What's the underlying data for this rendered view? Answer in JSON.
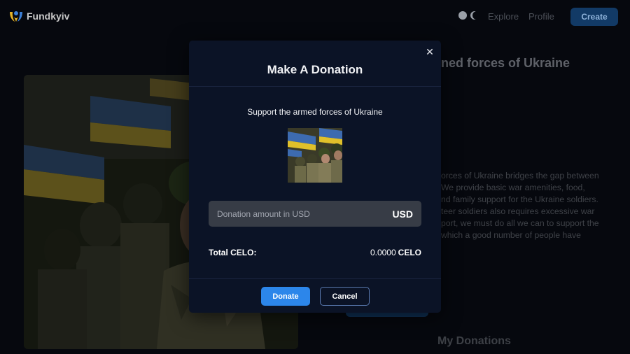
{
  "app": {
    "name": "Fundkyiv"
  },
  "nav": {
    "explore": "Explore",
    "profile": "Profile",
    "create": "Create"
  },
  "campaign": {
    "title": "Support the armed forces of Ukraine",
    "visible_title": "ned forces of Ukraine",
    "description_lines": [
      "orces of Ukraine bridges the gap between",
      "We provide basic war amenities, food,",
      "nd family support for the Ukraine soldiers.",
      "teer soldiers also requires excessive war",
      "port, we must do all we can to support the",
      "which a good number of people have"
    ]
  },
  "my_donations": {
    "heading": "My Donations"
  },
  "modal": {
    "title": "Make A Donation",
    "subtitle": "Support the armed forces of Ukraine",
    "amount_placeholder": "Donation amount in USD",
    "amount_value": "",
    "currency": "USD",
    "total_label": "Total CELO:",
    "total_amount": "0.0000",
    "total_unit": "CELO",
    "donate_label": "Donate",
    "cancel_label": "Cancel",
    "close_icon": "close-icon"
  },
  "colors": {
    "page_bg": "#06080e",
    "modal_bg": "#0b1326",
    "accent": "#2c86ea",
    "input_bg": "#373c46",
    "create_button_bg": "#123a66"
  }
}
